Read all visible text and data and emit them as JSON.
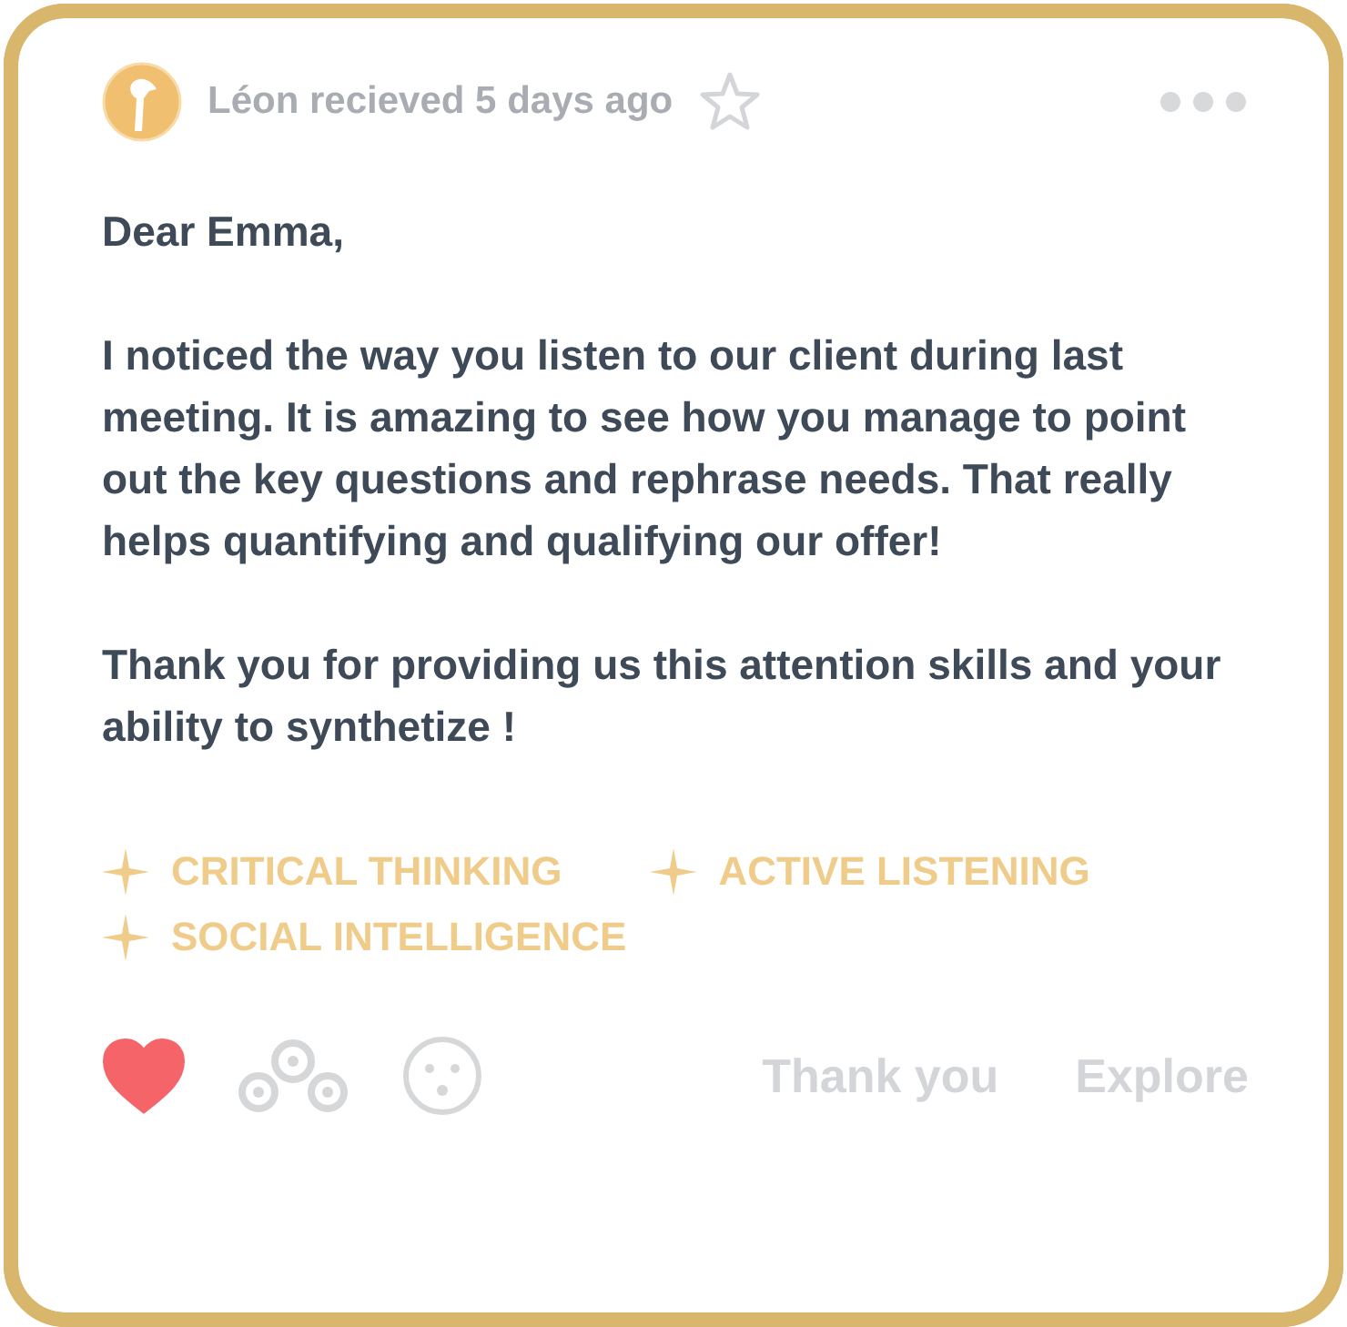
{
  "header": {
    "meta": "Léon recieved 5 days ago",
    "starred": false
  },
  "message": {
    "greeting": "Dear Emma,",
    "paragraphs": [
      "I noticed the way you listen to our client during last meeting. It is amazing to see how you manage to point out the key questions and rephrase needs. That really helps quantifying and qualifying our offer!",
      "Thank you for providing us this attention skills and your ability to synthetize !"
    ]
  },
  "skills": [
    "CRITICAL THINKING",
    "ACTIVE LISTENING",
    "SOCIAL INTELLIGENCE"
  ],
  "reactions": [
    {
      "kind": "heart",
      "selected": true
    },
    {
      "kind": "group",
      "selected": false
    },
    {
      "kind": "wow",
      "selected": false
    }
  ],
  "actions": [
    "Thank you",
    "Explore"
  ]
}
